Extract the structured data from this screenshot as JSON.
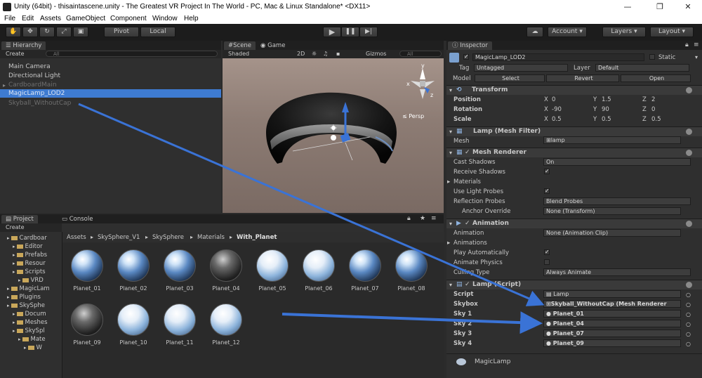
{
  "window": {
    "title": "Unity (64bit) - thisaintascene.unity - The Greatest VR Project In The World - PC, Mac & Linux Standalone* <DX11>",
    "minimize": "—",
    "restore": "❐",
    "close": "✕"
  },
  "menu": [
    "File",
    "Edit",
    "Assets",
    "GameObject",
    "Component",
    "Window",
    "Help"
  ],
  "toolbar": {
    "pivot": "Pivot",
    "local": "Local",
    "account": "Account",
    "layers": "Layers",
    "layout": "Layout"
  },
  "hierarchy": {
    "tab": "Hierarchy",
    "create": "Create",
    "search": "All",
    "items": [
      "Main Camera",
      "Directional Light",
      "CardboardMain",
      "MagicLamp_LOD2",
      "Skyball_WithoutCap"
    ]
  },
  "scene": {
    "tab_scene": "Scene",
    "tab_game": "Game",
    "shading": "Shaded",
    "mode_2d": "2D",
    "gizmos": "Gizmos",
    "search": "All",
    "persp": "Persp",
    "axis_y": "y",
    "axis_x": "x",
    "axis_z": "z"
  },
  "project": {
    "tab_project": "Project",
    "tab_console": "Console",
    "create": "Create",
    "breadcrumb": [
      "Assets",
      "SkySphere_V1",
      "SkySphere",
      "Materials",
      "With_Planet"
    ],
    "tree": [
      {
        "label": "Cardboar",
        "indent": 1
      },
      {
        "label": "Editor",
        "indent": 2
      },
      {
        "label": "Prefabs",
        "indent": 2
      },
      {
        "label": "Resour",
        "indent": 2
      },
      {
        "label": "Scripts",
        "indent": 2
      },
      {
        "label": "VRD",
        "indent": 3
      },
      {
        "label": "MagicLam",
        "indent": 1
      },
      {
        "label": "Plugins",
        "indent": 1
      },
      {
        "label": "SkySphe",
        "indent": 1
      },
      {
        "label": "Docum",
        "indent": 2
      },
      {
        "label": "Meshes",
        "indent": 2
      },
      {
        "label": "SkySpl",
        "indent": 2
      },
      {
        "label": "Mate",
        "indent": 3
      },
      {
        "label": "W",
        "indent": 4
      }
    ],
    "assets": [
      "Planet_01",
      "Planet_02",
      "Planet_03",
      "Planet_04",
      "Planet_05",
      "Planet_06",
      "Planet_07",
      "Planet_08",
      "Planet_09",
      "Planet_10",
      "Planet_11",
      "Planet_12"
    ]
  },
  "inspector": {
    "tab": "Inspector",
    "object_name": "MagicLamp_LOD2",
    "static": "Static",
    "tag_label": "Tag",
    "tag_value": "Untagged",
    "layer_label": "Layer",
    "layer_value": "Default",
    "model_label": "Model",
    "model_select": "Select",
    "model_revert": "Revert",
    "model_open": "Open",
    "transform": {
      "header": "Transform",
      "position_label": "Position",
      "rotation_label": "Rotation",
      "scale_label": "Scale",
      "position": {
        "x": "0",
        "y": "1.5",
        "z": "2"
      },
      "rotation": {
        "x": "-90",
        "y": "90",
        "z": "0"
      },
      "scale": {
        "x": "0.5",
        "y": "0.5",
        "z": "0.5"
      },
      "x_label": "X",
      "y_label": "Y",
      "z_label": "Z"
    },
    "mesh_filter": {
      "header": "Lamp (Mesh Filter)",
      "mesh_label": "Mesh",
      "mesh_value": "lamp"
    },
    "mesh_renderer": {
      "header": "Mesh Renderer",
      "cast_shadows_label": "Cast Shadows",
      "cast_shadows_value": "On",
      "receive_shadows_label": "Receive Shadows",
      "materials_label": "Materials",
      "use_light_probes_label": "Use Light Probes",
      "reflection_probes_label": "Reflection Probes",
      "reflection_probes_value": "Blend Probes",
      "anchor_override_label": "Anchor Override",
      "anchor_override_value": "None (Transform)"
    },
    "animation": {
      "header": "Animation",
      "animation_label": "Animation",
      "animation_value": "None (Animation Clip)",
      "animations_label": "Animations",
      "play_auto_label": "Play Automatically",
      "animate_physics_label": "Animate Physics",
      "culling_label": "Culling Type",
      "culling_value": "Always Animate"
    },
    "lamp_script": {
      "header": "Lamp (Script)",
      "script_label": "Script",
      "script_value": "Lamp",
      "skybox_label": "Skybox",
      "skybox_value": "Skyball_WithoutCap (Mesh Renderer",
      "sky1_label": "Sky 1",
      "sky1_value": "Planet_01",
      "sky2_label": "Sky 2",
      "sky2_value": "Planet_04",
      "sky3_label": "Sky 3",
      "sky3_value": "Planet_07",
      "sky4_label": "Sky 4",
      "sky4_value": "Planet_09"
    },
    "next_component": "MagicLamp"
  },
  "colors": {
    "arrow": "#3a73d6",
    "selection": "#3e7bd1",
    "accent": "#5b9ae8"
  }
}
